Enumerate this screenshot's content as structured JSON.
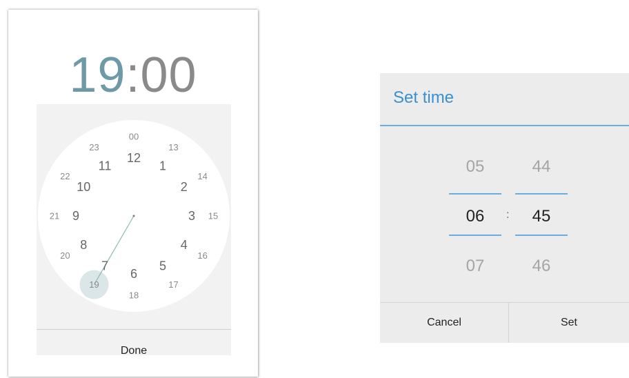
{
  "clock_picker": {
    "hours": "19",
    "colon": ":",
    "minutes": "00",
    "done_label": "Done",
    "selected_hour": "19",
    "colors": {
      "hours_accent": "#6e9aa8",
      "selector": "#dbe6e8",
      "hand": "#8fb7b0"
    },
    "outer_hours": [
      "00",
      "13",
      "14",
      "15",
      "16",
      "17",
      "18",
      "19",
      "20",
      "21",
      "22",
      "23"
    ],
    "inner_hours": [
      "12",
      "1",
      "2",
      "3",
      "4",
      "5",
      "6",
      "7",
      "8",
      "9",
      "10",
      "11"
    ]
  },
  "spinner_dialog": {
    "title": "Set time",
    "hour_prev": "05",
    "hour_current": "06",
    "hour_next": "07",
    "separator": ":",
    "minute_prev": "44",
    "minute_current": "45",
    "minute_next": "46",
    "cancel_label": "Cancel",
    "set_label": "Set",
    "colors": {
      "accent": "#3a8fd1"
    }
  }
}
